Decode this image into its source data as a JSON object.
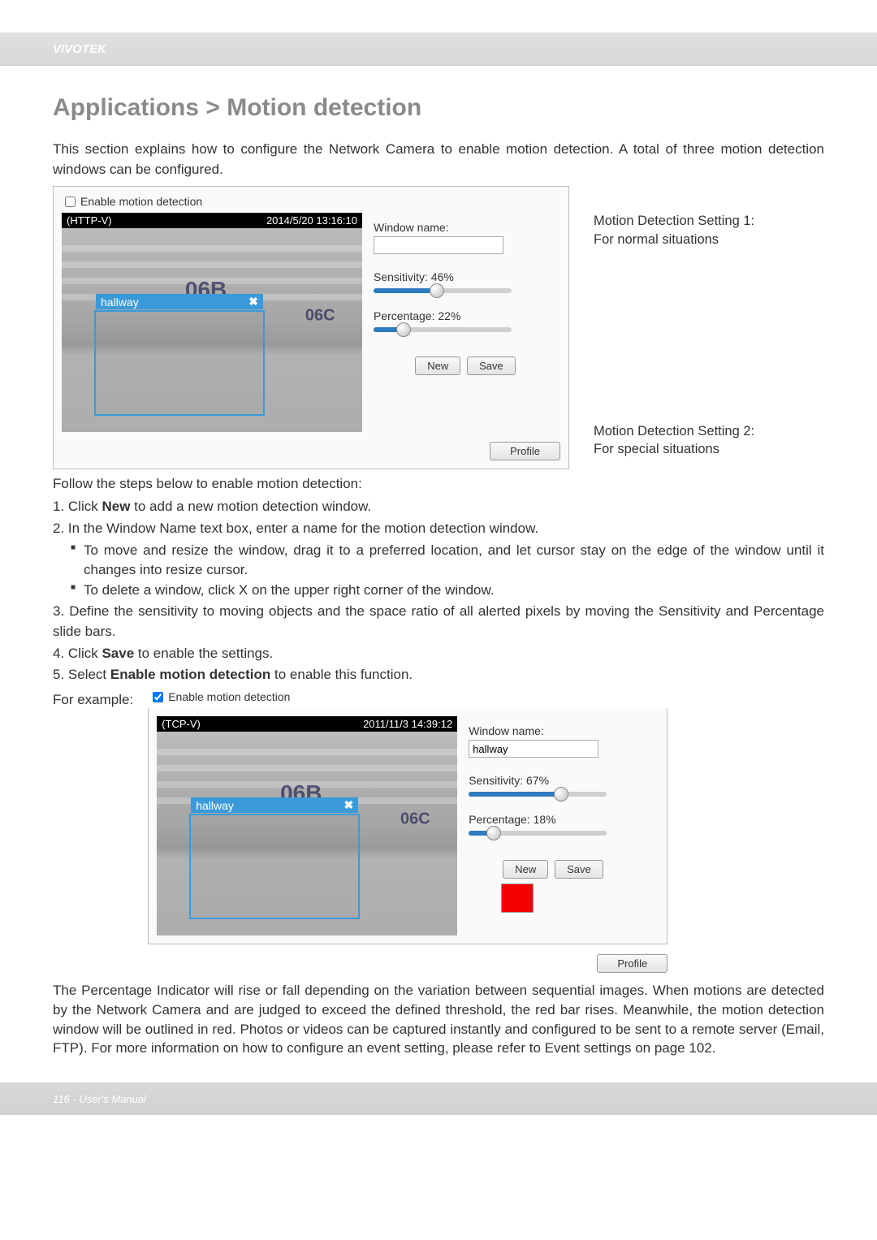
{
  "brand": "VIVOTEK",
  "section_title": "Applications > Motion detection",
  "intro": "This section explains how to configure the Network Camera to enable motion detection. A total of three motion detection windows can be configured.",
  "panel1": {
    "enable_label": "Enable motion detection",
    "enable_checked": false,
    "video_proto": "(HTTP-V)",
    "timestamp": "2014/5/20 13:16:10",
    "room_main": "06B",
    "room_side": "06C",
    "window_title": "hallway",
    "controls": {
      "wname_label": "Window name:",
      "wname_value": "",
      "sens_label": "Sensitivity: 46%",
      "sens_pct": 46,
      "perc_label": "Percentage: 22%",
      "perc_pct": 22,
      "btn_new": "New",
      "btn_save": "Save"
    },
    "profile_btn": "Profile"
  },
  "annot1": {
    "title": "Motion Detection Setting 1:",
    "sub": "For normal situations"
  },
  "annot2": {
    "title": "Motion Detection Setting 2:",
    "sub": "For special situations"
  },
  "follow": "Follow the steps below to enable motion detection:",
  "steps": {
    "s1": "1. Click New to add a new motion detection window.",
    "s1_bold": "New",
    "s2": "2. In the Window Name text box, enter a name for the motion detection window.",
    "s2a": "To move and resize the window, drag it to a preferred location, and let cursor stay on the edge of the window until it changes into resize cursor.",
    "s2b": "To delete a window, click X on the upper right corner of the window.",
    "s3": "3. Define the sensitivity to moving objects and the space ratio of all alerted pixels by moving the Sensitivity and Percentage slide bars.",
    "s4": "4. Click Save to enable the settings.",
    "s4_bold": "Save",
    "s5": "5. Select Enable motion detection to enable this function.",
    "s5_bold": "Enable motion detection"
  },
  "for_example": "For example:",
  "panel2": {
    "enable_label": "Enable motion detection",
    "enable_checked": true,
    "video_proto": "(TCP-V)",
    "timestamp": "2011/11/3 14:39:12",
    "room_main": "06B",
    "room_side": "06C",
    "window_title": "hallway",
    "controls": {
      "wname_label": "Window name:",
      "wname_value": "hallway",
      "sens_label": "Sensitivity: 67%",
      "sens_pct": 67,
      "perc_label": "Percentage: 18%",
      "perc_pct": 18,
      "btn_new": "New",
      "btn_save": "Save"
    },
    "profile_btn": "Profile"
  },
  "closing": "The Percentage Indicator will rise or fall depending on the variation between sequential images. When motions are detected by the Network Camera and are judged to exceed the defined threshold, the red bar rises. Meanwhile, the motion detection window will be outlined in red. Photos or videos can be captured instantly and configured to be sent to a remote server (Email, FTP). For more information on how to configure an event setting, please refer to Event settings on page 102.",
  "footer": "116 - User's Manual"
}
